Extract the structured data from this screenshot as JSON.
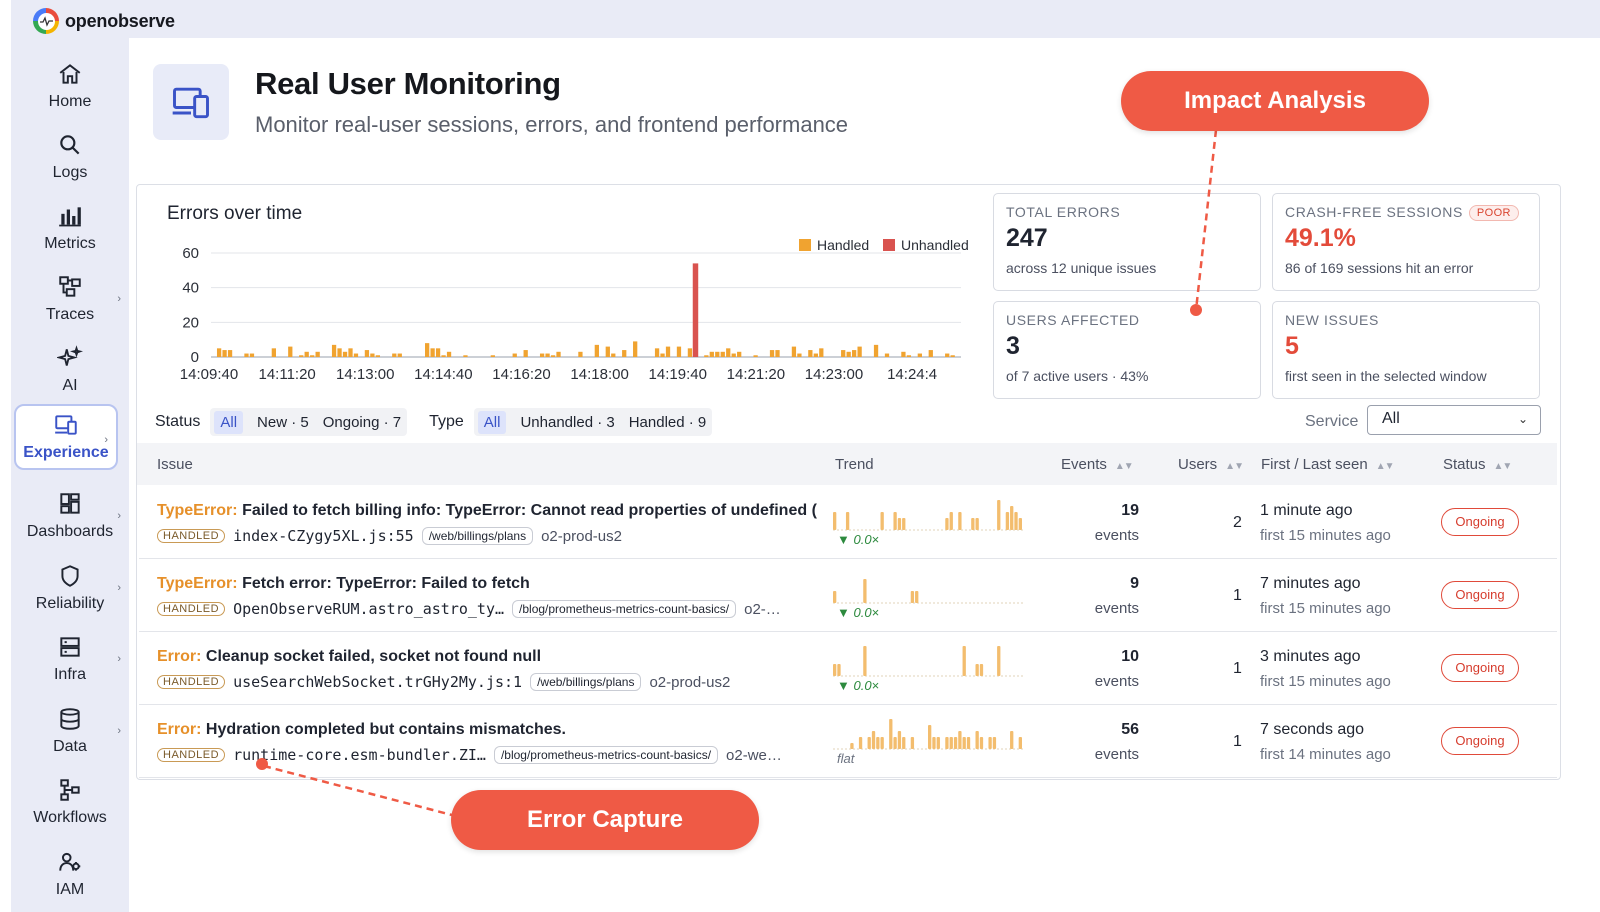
{
  "app": {
    "name": "openobserve"
  },
  "sidebar": {
    "items": [
      {
        "label": "Home",
        "icon": "home-icon"
      },
      {
        "label": "Logs",
        "icon": "search-icon"
      },
      {
        "label": "Metrics",
        "icon": "bar-chart-icon"
      },
      {
        "label": "Traces",
        "icon": "traces-icon"
      },
      {
        "label": "AI",
        "icon": "sparkles-icon"
      },
      {
        "label": "Experience",
        "icon": "devices-icon",
        "active": true
      },
      {
        "label": "Dashboards",
        "icon": "dashboard-icon"
      },
      {
        "label": "Reliability",
        "icon": "shield-icon"
      },
      {
        "label": "Infra",
        "icon": "server-icon"
      },
      {
        "label": "Data",
        "icon": "database-icon"
      },
      {
        "label": "Workflows",
        "icon": "workflow-icon"
      },
      {
        "label": "IAM",
        "icon": "users-icon"
      }
    ]
  },
  "header": {
    "title": "Real User Monitoring",
    "subtitle": "Monitor real-user sessions, errors, and frontend performance"
  },
  "chart_data": {
    "type": "bar",
    "title": "Errors over time",
    "xlabel": "",
    "ylabel": "",
    "ylim": [
      0,
      60
    ],
    "yticks": [
      "0",
      "20",
      "40",
      "60"
    ],
    "xticks": [
      "14:09:40",
      "14:11:20",
      "14:13:00",
      "14:14:40",
      "14:16:20",
      "14:18:00",
      "14:19:40",
      "14:21:20",
      "14:23:00",
      "14:24:4"
    ],
    "legend": {
      "placement": "top-right"
    },
    "series": [
      {
        "name": "Handled",
        "color": "#f0a330",
        "values": [
          0,
          5,
          4,
          4,
          0,
          0,
          2,
          2,
          0,
          0,
          0,
          5,
          0,
          0,
          6,
          0,
          1,
          3,
          1,
          3,
          0,
          0,
          7,
          5,
          3,
          5,
          2,
          0,
          4,
          2,
          1,
          0,
          0,
          2,
          2,
          0,
          0,
          0,
          0,
          8,
          5,
          5,
          1,
          3,
          0,
          0,
          1,
          0,
          0,
          0,
          0,
          1,
          0,
          0,
          0,
          2,
          0,
          4,
          0,
          0,
          2,
          2,
          1,
          3,
          0,
          0,
          0,
          3,
          0,
          0,
          7,
          0,
          6,
          2,
          0,
          4,
          0,
          9,
          0,
          0,
          0,
          5,
          2,
          6,
          0,
          6,
          0,
          5,
          0,
          0,
          1,
          3,
          3,
          3,
          5,
          2,
          3,
          0,
          0,
          1,
          0,
          0,
          4,
          4,
          0,
          0,
          6,
          2,
          0,
          4,
          2,
          5,
          0,
          0,
          0,
          4,
          3,
          4,
          6,
          0,
          0,
          7,
          0,
          2,
          0,
          0,
          3,
          1,
          0,
          2,
          0,
          4,
          0,
          0,
          2,
          1,
          0
        ]
      },
      {
        "name": "Unhandled",
        "color": "#d9534f",
        "index": 88,
        "value": 54
      }
    ]
  },
  "stats": [
    {
      "caption": "TOTAL ERRORS",
      "value": "247",
      "sub": "across 12 unique issues",
      "red": false
    },
    {
      "caption": "CRASH-FREE SESSIONS",
      "badge": "POOR",
      "value": "49.1%",
      "sub": "86 of 169 sessions hit an error",
      "red": true
    },
    {
      "caption": "USERS AFFECTED",
      "value": "3",
      "sub": "of 7 active users · 43%",
      "red": false
    },
    {
      "caption": "NEW ISSUES",
      "value": "5",
      "sub": "first seen in the selected window",
      "red": true
    }
  ],
  "filters": {
    "status_label": "Status",
    "status_options": [
      "All",
      "New · 5",
      "Ongoing · 7"
    ],
    "type_label": "Type",
    "type_options": [
      "All",
      "Unhandled · 3",
      "Handled · 9"
    ],
    "service_label": "Service",
    "service_value": "All"
  },
  "table": {
    "columns": [
      "Issue",
      "Trend",
      "Events",
      "Users",
      "First / Last seen",
      "Status"
    ],
    "rows": [
      {
        "etype": "TypeError:",
        "message": "Failed to fetch billing info: TypeError: Cannot read properties of undefined (…",
        "tag": "HANDLED",
        "file": "index-CZygy5XL.js:55",
        "route": "/web/billings/plans",
        "env": "o2-prod-us2",
        "trend": [
          3,
          0,
          0,
          3,
          0,
          0,
          0,
          0,
          0,
          0,
          0,
          3,
          0,
          0,
          3,
          2,
          2,
          0,
          0,
          0,
          0,
          0,
          0,
          0,
          0,
          0,
          2,
          3,
          0,
          3,
          0,
          0,
          2,
          2,
          0,
          0,
          0,
          0,
          5,
          0,
          3,
          4,
          3,
          2
        ],
        "trend_label": "▼ 0.0×",
        "events": "19",
        "events_label": "events",
        "users": "2",
        "last_seen": "1 minute ago",
        "first_seen": "first 15 minutes ago",
        "status": "Ongoing"
      },
      {
        "etype": "TypeError:",
        "message": "Fetch error: TypeError: Failed to fetch",
        "tag": "HANDLED",
        "file": "OpenObserveRUM.astro_astro_ty…",
        "route": "/blog/prometheus-metrics-count-basics/",
        "env": "o2-…",
        "trend": [
          0,
          0,
          0,
          0,
          0,
          0,
          0,
          0,
          0,
          0,
          0,
          0,
          0,
          0,
          3,
          0,
          0,
          0,
          0,
          0,
          0,
          0,
          0,
          0,
          0,
          0,
          0,
          0,
          0,
          0,
          0,
          0,
          0,
          0,
          0,
          0,
          0,
          0,
          0,
          0,
          0,
          0,
          0,
          0,
          0,
          0,
          0,
          0,
          0,
          0,
          0,
          0,
          0,
          0,
          0,
          0,
          0,
          0,
          0,
          0,
          0,
          0,
          0,
          0,
          0,
          0
        ],
        "trend_compact": [
          2,
          0,
          0,
          0,
          0,
          0,
          0,
          4,
          0,
          0,
          0,
          0,
          0,
          0,
          0,
          0,
          0,
          0,
          2,
          2,
          0,
          0,
          0,
          0,
          0,
          0,
          0,
          0,
          0,
          0,
          0,
          0,
          0,
          0,
          0,
          0,
          0,
          0,
          0,
          0,
          0,
          0,
          0,
          0
        ],
        "trend_label": "▼ 0.0×",
        "events": "9",
        "events_label": "events",
        "users": "1",
        "last_seen": "7 minutes ago",
        "first_seen": "first 15 minutes ago",
        "status": "Ongoing"
      },
      {
        "etype": "Error:",
        "message": "Cleanup socket failed, socket not found null",
        "tag": "HANDLED",
        "file": "useSearchWebSocket.trGHy2My.js:1",
        "route": "/web/billings/plans",
        "env": "o2-prod-us2",
        "trend": [
          2,
          2,
          0,
          0,
          0,
          0,
          0,
          5,
          0,
          0,
          0,
          0,
          0,
          0,
          0,
          0,
          0,
          0,
          0,
          0,
          0,
          0,
          0,
          0,
          0,
          0,
          0,
          0,
          0,
          0,
          5,
          0,
          0,
          2,
          2,
          0,
          0,
          0,
          5,
          0,
          0,
          0,
          0,
          0
        ],
        "trend_label": "▼ 0.0×",
        "events": "10",
        "events_label": "events",
        "users": "1",
        "last_seen": "3 minutes ago",
        "first_seen": "first 15 minutes ago",
        "status": "Ongoing"
      },
      {
        "etype": "Error:",
        "message": "Hydration completed but contains mismatches.",
        "tag": "HANDLED",
        "file": "runtime-core.esm-bundler.ZI…",
        "route": "/blog/prometheus-metrics-count-basics/",
        "env": "o2-we…",
        "trend": [
          0,
          0,
          0,
          0,
          1,
          0,
          2,
          0,
          2,
          3,
          2,
          2,
          0,
          5,
          2,
          3,
          2,
          0,
          2,
          0,
          0,
          0,
          4,
          2,
          2,
          0,
          2,
          2,
          2,
          3,
          2,
          2,
          0,
          3,
          2,
          0,
          2,
          2,
          0,
          0,
          0,
          3,
          0,
          2
        ],
        "trend_label": "flat",
        "events": "56",
        "events_label": "events",
        "users": "1",
        "last_seen": "7 seconds ago",
        "first_seen": "first 14 minutes ago",
        "status": "Ongoing"
      }
    ]
  },
  "annotations": {
    "impact": "Impact Analysis",
    "capture": "Error Capture",
    "color": "#ef5a45"
  }
}
